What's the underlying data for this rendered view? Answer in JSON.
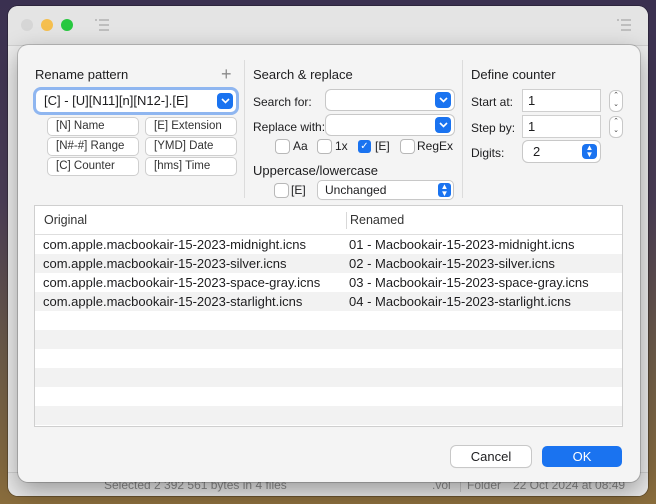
{
  "background_window": {
    "status_text": "Selected 2 392 561 bytes in 4 files",
    "status_kind": ".vol",
    "status_type": "Folder",
    "status_date": "22 Oct 2024 at 08:49"
  },
  "rename_pattern": {
    "title": "Rename pattern",
    "add_label": "+",
    "pattern_value": "[C] - [U][N11][n][N12-].[E]",
    "tokens": [
      {
        "label": "[N] Name"
      },
      {
        "label": "[E] Extension"
      },
      {
        "label": "[N#-#] Range"
      },
      {
        "label": "[YMD] Date"
      },
      {
        "label": "[C] Counter"
      },
      {
        "label": "[hms] Time"
      }
    ]
  },
  "search_replace": {
    "title": "Search & replace",
    "search_label": "Search for:",
    "search_value": "",
    "replace_label": "Replace with:",
    "replace_value": "",
    "options": [
      {
        "label": "Aa",
        "checked": false
      },
      {
        "label": "1x",
        "checked": false
      },
      {
        "label": "[E]",
        "checked": true
      },
      {
        "label": "RegEx",
        "checked": false
      }
    ],
    "case_title": "Uppercase/lowercase",
    "case_ext_label": "[E]",
    "case_ext_checked": false,
    "case_value": "Unchanged"
  },
  "counter": {
    "title": "Define counter",
    "start_label": "Start at:",
    "start_value": "1",
    "step_label": "Step by:",
    "step_value": "1",
    "digits_label": "Digits:",
    "digits_value": "2"
  },
  "table": {
    "columns": [
      "Original",
      "Renamed"
    ],
    "rows": [
      {
        "original": "com.apple.macbookair-15-2023-midnight.icns",
        "renamed": "01 - Macbookair-15-2023-midnight.icns"
      },
      {
        "original": "com.apple.macbookair-15-2023-silver.icns",
        "renamed": "02 - Macbookair-15-2023-silver.icns"
      },
      {
        "original": "com.apple.macbookair-15-2023-space-gray.icns",
        "renamed": "03 - Macbookair-15-2023-space-gray.icns"
      },
      {
        "original": "com.apple.macbookair-15-2023-starlight.icns",
        "renamed": "04 - Macbookair-15-2023-starlight.icns"
      }
    ],
    "empty_rows": 7
  },
  "buttons": {
    "cancel": "Cancel",
    "ok": "OK"
  },
  "colors": {
    "accent": "#1a73f0"
  }
}
